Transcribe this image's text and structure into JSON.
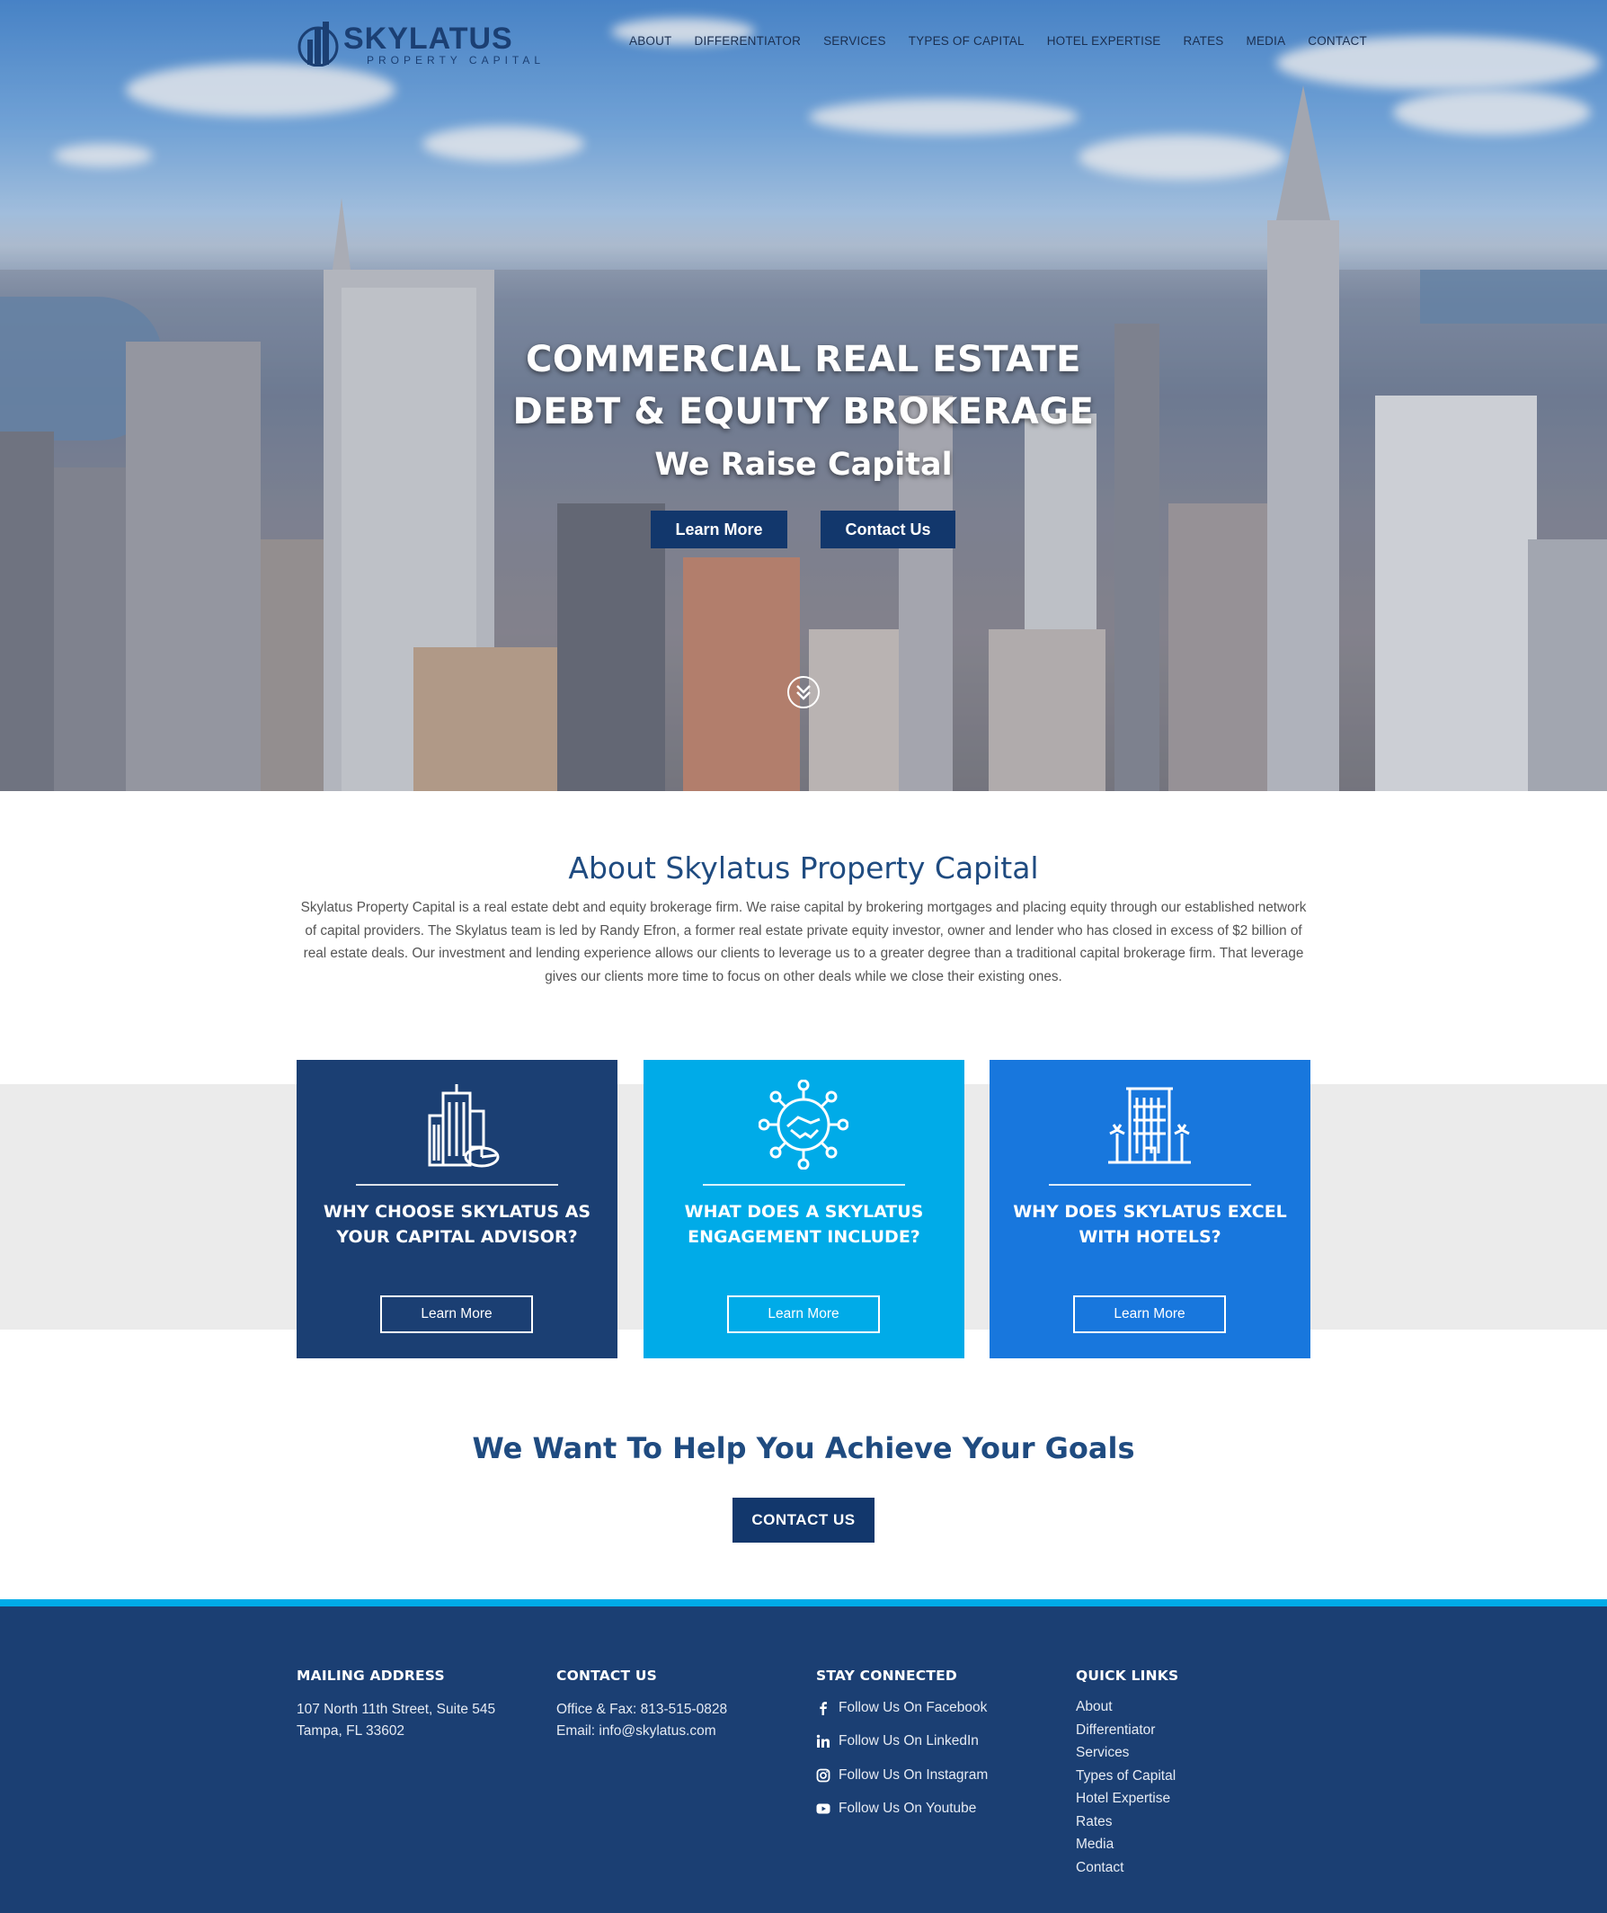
{
  "brand": {
    "name": "SKYLATUS",
    "tagline": "PROPERTY CAPITAL",
    "colors": {
      "navy": "#1b3f73",
      "cyan": "#00abe8",
      "blue": "#1877dd",
      "dark_button": "#12376c"
    }
  },
  "nav": {
    "items": [
      "ABOUT",
      "DIFFERENTIATOR",
      "SERVICES",
      "TYPES OF CAPITAL",
      "HOTEL EXPERTISE",
      "RATES",
      "MEDIA",
      "CONTACT"
    ]
  },
  "hero": {
    "line1": "COMMERCIAL REAL ESTATE",
    "line2": "DEBT & EQUITY BROKERAGE",
    "line3": "We Raise Capital",
    "learn_more": "Learn More",
    "contact_us": "Contact Us",
    "scroll_icon": "chevron-down-circle-icon"
  },
  "about": {
    "title": "About Skylatus Property Capital",
    "text": "Skylatus Property Capital is a real estate debt and equity brokerage firm.  We raise capital by brokering mortgages and placing equity through our established network of capital providers. The Skylatus team is led by Randy Efron, a former real estate private equity investor, owner and lender who has closed in excess of $2 billion of real estate deals. Our investment and lending experience allows our clients to leverage us to a greater degree than a traditional capital brokerage firm. That leverage gives our clients more time to focus on other deals while we close their existing ones."
  },
  "cards": [
    {
      "title": "WHY CHOOSE SKYLATUS AS YOUR CAPITAL ADVISOR?",
      "button": "Learn More",
      "icon": "building-chart-icon"
    },
    {
      "title": "WHAT DOES A SKYLATUS ENGAGEMENT INCLUDE?",
      "button": "Learn More",
      "icon": "handshake-network-icon"
    },
    {
      "title": "WHY DOES SKYLATUS EXCEL WITH HOTELS?",
      "button": "Learn More",
      "icon": "hotel-palms-icon"
    }
  ],
  "goals": {
    "title": "We Want To Help You Achieve Your Goals",
    "button": "CONTACT US"
  },
  "footer": {
    "mailing": {
      "heading": "MAILING ADDRESS",
      "line1": "107 North 11th Street, Suite 545",
      "line2": "Tampa, FL 33602"
    },
    "contact": {
      "heading": "CONTACT US",
      "line1": "Office & Fax: 813-515-0828",
      "line2": "Email: info@skylatus.com"
    },
    "social": {
      "heading": "STAY CONNECTED",
      "items": [
        {
          "label": "Follow Us On Facebook",
          "icon": "facebook-icon"
        },
        {
          "label": "Follow Us On LinkedIn",
          "icon": "linkedin-icon"
        },
        {
          "label": "Follow Us On Instagram",
          "icon": "instagram-icon"
        },
        {
          "label": "Follow Us On Youtube",
          "icon": "youtube-icon"
        }
      ]
    },
    "quick": {
      "heading": "QUICK LINKS",
      "items": [
        "About",
        "Differentiator",
        "Services",
        "Types of Capital",
        "Hotel Expertise",
        "Rates",
        "Media",
        "Contact"
      ]
    }
  }
}
